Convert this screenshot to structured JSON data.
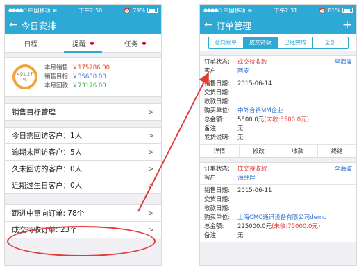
{
  "left": {
    "status": {
      "carrier": "中国移动",
      "time": "下午2:50",
      "battery": "79%",
      "battery_level": 0.79
    },
    "nav": {
      "title": "今日安排"
    },
    "tabs": [
      {
        "label": "日程",
        "active": false,
        "dot": false
      },
      {
        "label": "提醒",
        "active": true,
        "dot": true
      },
      {
        "label": "任务",
        "active": false,
        "dot": true
      }
    ],
    "summary": {
      "percent": "491.27",
      "percent_unit": "%",
      "lines": [
        {
          "label": "本月销售:",
          "value": "￥175286.00"
        },
        {
          "label": "销售目标:",
          "value": "￥35680.00"
        },
        {
          "label": "本月回款:",
          "value": "￥73176.00"
        }
      ]
    },
    "sales_target_row": "销售目标管理",
    "reminders": [
      "今日需回访客户：1人",
      "逾期未回访客户：5人",
      "久未回访的客户：0人",
      "近期过生日客户：0人"
    ],
    "orders": [
      "跟进中意向订单: 78个",
      "成交待收订单: 23个"
    ]
  },
  "right": {
    "status": {
      "carrier": "中国移动",
      "time": "下午2:31",
      "battery": "81%",
      "battery_level": 0.81
    },
    "nav": {
      "title": "订单管理",
      "add": "+"
    },
    "segments": [
      {
        "label": "意向跟单",
        "active": false
      },
      {
        "label": "成交待收",
        "active": true
      },
      {
        "label": "已经完成",
        "active": false
      },
      {
        "label": "全部",
        "active": false
      }
    ],
    "cards": [
      {
        "status_label": "订单状态:",
        "status_value": "成交待收款",
        "owner": "李海波",
        "customer_label": "客户",
        "customer_value": "阿麦",
        "fields": [
          {
            "k": "销售日期:",
            "v": "2015-06-14"
          },
          {
            "k": "交货日期:",
            "v": ""
          },
          {
            "k": "收款日期:",
            "v": ""
          },
          {
            "k": "购买单位:",
            "v": "中外合资MM企业"
          },
          {
            "k": "总金额:",
            "v": "5500.0元",
            "extra": "(未收:5500.0元)"
          },
          {
            "k": "备注:",
            "v": "无"
          },
          {
            "k": "发货说明:",
            "v": "无"
          }
        ],
        "actions": [
          "详情",
          "修改",
          "收款",
          "终结"
        ]
      },
      {
        "status_label": "订单状态:",
        "status_value": "成交待收款",
        "owner": "李海波",
        "customer_label": "客户",
        "customer_value": "海经理",
        "fields": [
          {
            "k": "销售日期:",
            "v": "2015-06-11"
          },
          {
            "k": "交货日期:",
            "v": ""
          },
          {
            "k": "收款日期:",
            "v": ""
          },
          {
            "k": "购买单位:",
            "v": "上海CMC通讯设备有限公司demo"
          },
          {
            "k": "总金额:",
            "v": "225000.0元",
            "extra": "(未收:75000.0元)"
          },
          {
            "k": "备注:",
            "v": "无"
          }
        ]
      }
    ]
  },
  "colors": {
    "accent": "#2ea8d5",
    "highlight": "#e23b3b"
  }
}
